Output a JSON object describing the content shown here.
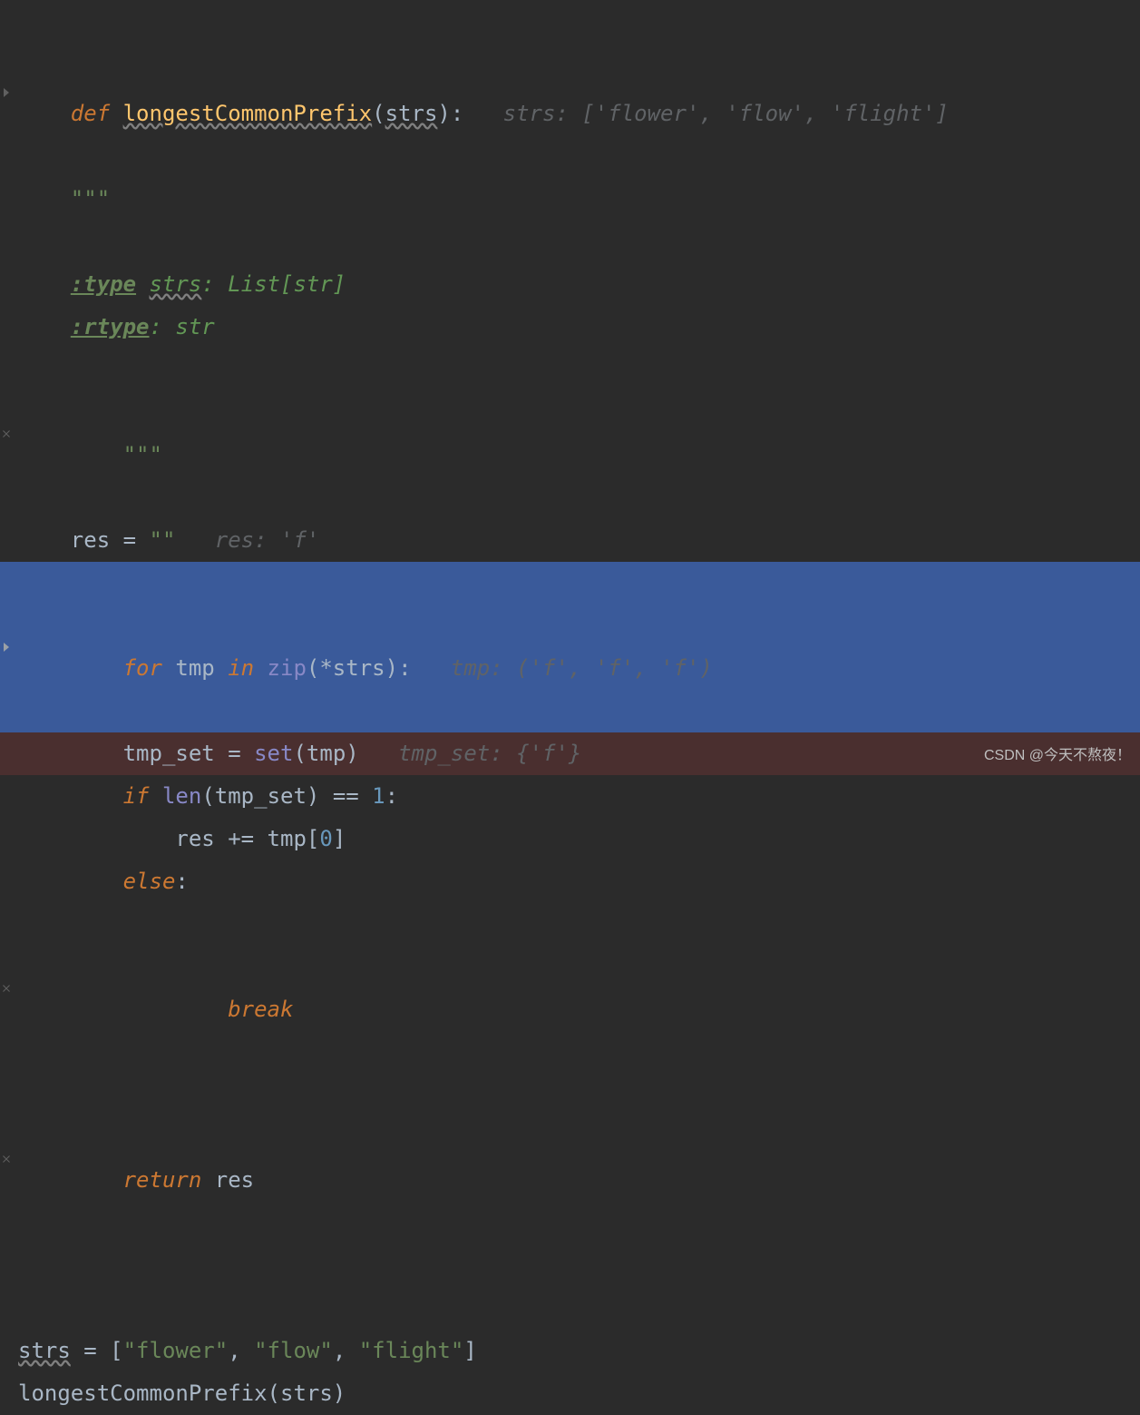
{
  "code": {
    "l1": {
      "def": "def ",
      "fn": "longestCommonPrefix",
      "lp": "(",
      "param": "strs",
      "rp": ")",
      "colon": ":",
      "sp": "   ",
      "hint": "strs: ['flower', 'flow', 'flight']"
    },
    "l2": {
      "indent": "    ",
      "q": "\"\"\""
    },
    "l3": {
      "text": ""
    },
    "l4": {
      "indent": "    ",
      "tag": ":type",
      "sp": " ",
      "param": "strs",
      "rest": ": List[str]"
    },
    "l5": {
      "indent": "    ",
      "tag": ":rtype",
      "rest": ": str"
    },
    "l6": {
      "indent": "    ",
      "q": "\"\"\""
    },
    "l7": {
      "indent": "    ",
      "var": "res",
      "eq": " = ",
      "val": "\"\"",
      "sp": "   ",
      "hint": "res: 'f'"
    },
    "l8": {
      "indent": "    ",
      "for": "for ",
      "var": "tmp",
      "in": " in ",
      "fn": "zip",
      "args": "(*strs)",
      "colon": ":",
      "sp": "   ",
      "hint": "tmp: ('f', 'f', 'f')"
    },
    "l9": {
      "indent": "        ",
      "var": "tmp_set",
      "eq": " = ",
      "fn": "set",
      "args": "(tmp)",
      "sp": "   ",
      "hint": "tmp_set: {'f'}"
    },
    "l10": {
      "indent": "        ",
      "if": "if ",
      "fn": "len",
      "lp": "(",
      "arg": "tmp_set",
      "rp": ")",
      "eq": " == ",
      "num": "1",
      "colon": ":"
    },
    "l11": {
      "indent": "            ",
      "var": "res",
      "op": " += ",
      "arr": "tmp",
      "lb": "[",
      "idx": "0",
      "rb": "]"
    },
    "l12": {
      "indent": "        ",
      "else": "else",
      "colon": ":"
    },
    "l13": {
      "indent": "            ",
      "break": "break"
    },
    "l14": {
      "indent": "    ",
      "return": "return ",
      "var": "res"
    },
    "l15": {
      "text": ""
    },
    "l16": {
      "text": ""
    },
    "l17": {
      "var": "strs",
      "eq": " = ",
      "lb": "[",
      "s1": "\"flower\"",
      "c1": ", ",
      "s2": "\"flow\"",
      "c2": ", ",
      "s3": "\"flight\"",
      "rb": "]"
    },
    "l18": {
      "fn": "longestCommonPrefix",
      "lp": "(",
      "arg": "strs",
      "rp": ")"
    }
  },
  "watermark": "CSDN @今天不熬夜！"
}
